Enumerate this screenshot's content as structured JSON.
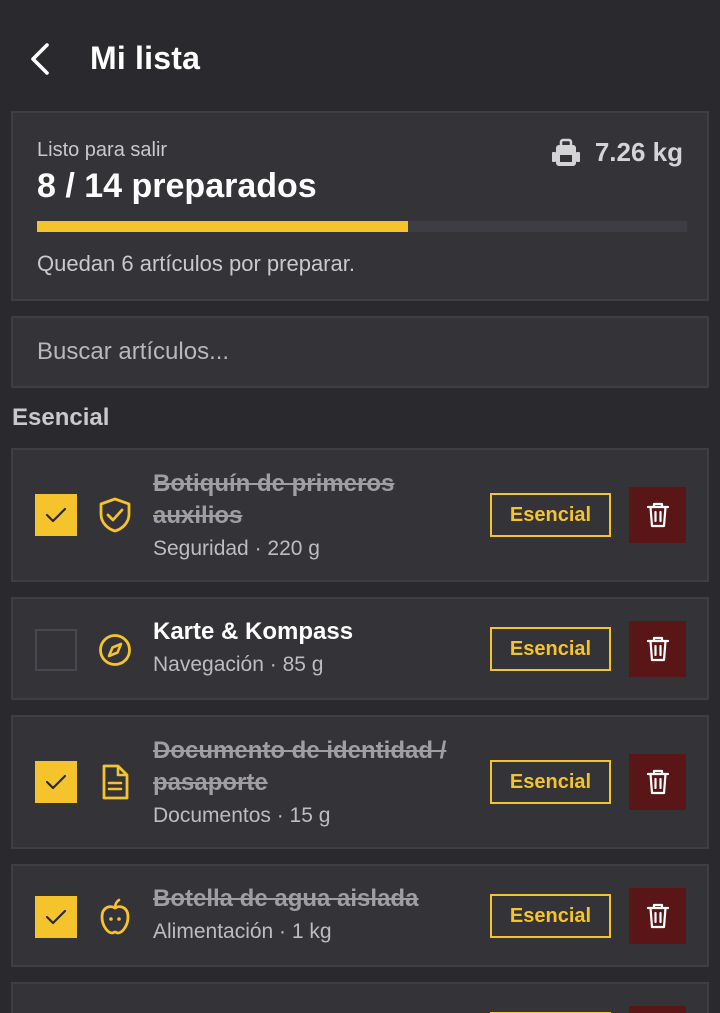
{
  "header": {
    "title": "Mi lista"
  },
  "summary": {
    "label": "Listo para salir",
    "count": "8 / 14 preparados",
    "weight": "7.26 kg",
    "progress_fraction": 0.5714,
    "remaining": "Quedan 6 artículos por preparar."
  },
  "search": {
    "placeholder": "Buscar artículos..."
  },
  "section": {
    "title": "Esencial"
  },
  "items": [
    {
      "name": "Botiquín de primeros auxilios",
      "meta": "Seguridad · 220 g",
      "checked": true,
      "icon": "shield-check-icon",
      "tag": "Esencial"
    },
    {
      "name": "Karte & Kompass",
      "meta": "Navegación · 85 g",
      "checked": false,
      "icon": "compass-icon",
      "tag": "Esencial"
    },
    {
      "name": "Documento de identidad / pasaporte",
      "meta": "Documentos · 15 g",
      "checked": true,
      "icon": "document-icon",
      "tag": "Esencial"
    },
    {
      "name": "Botella de agua aislada",
      "meta": "Alimentación · 1 kg",
      "checked": true,
      "icon": "apple-icon",
      "tag": "Esencial"
    }
  ],
  "colors": {
    "accent": "#f5c32c",
    "background": "#2a2a2e",
    "card": "#333338",
    "danger": "#5a1616"
  }
}
